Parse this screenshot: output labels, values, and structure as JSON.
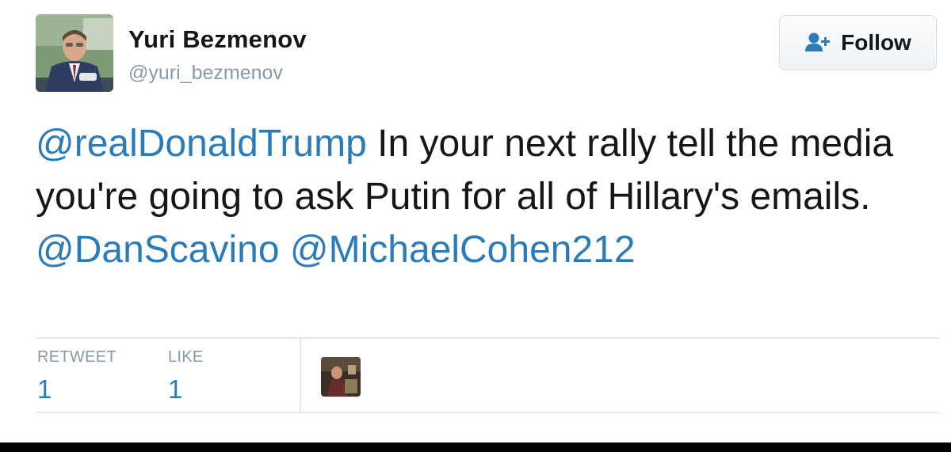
{
  "author": {
    "name": "Yuri Bezmenov",
    "handle": "@yuri_bezmenov",
    "avatar_icon": "profile-photo"
  },
  "follow_button": {
    "label": "Follow",
    "icon": "add-user-icon",
    "icon_color": "#2b7bb9"
  },
  "tweet": {
    "segments": [
      {
        "type": "mention",
        "text": "@realDonaldTrump"
      },
      {
        "type": "text",
        "text": " In your next rally tell the media you're going to ask Putin for all of Hillary's emails. "
      },
      {
        "type": "mention",
        "text": "@DanScavino"
      },
      {
        "type": "text",
        "text": " "
      },
      {
        "type": "mention",
        "text": "@MichaelCohen212"
      }
    ]
  },
  "stats": {
    "retweets": {
      "label": "RETWEET",
      "count": "1"
    },
    "likes": {
      "label": "LIKE",
      "count": "1"
    }
  },
  "likers": [
    {
      "icon": "liker-avatar"
    }
  ],
  "colors": {
    "link": "#2b7bb9",
    "text": "#14171a",
    "muted": "#8899a6",
    "divider": "#e1e8ed"
  }
}
